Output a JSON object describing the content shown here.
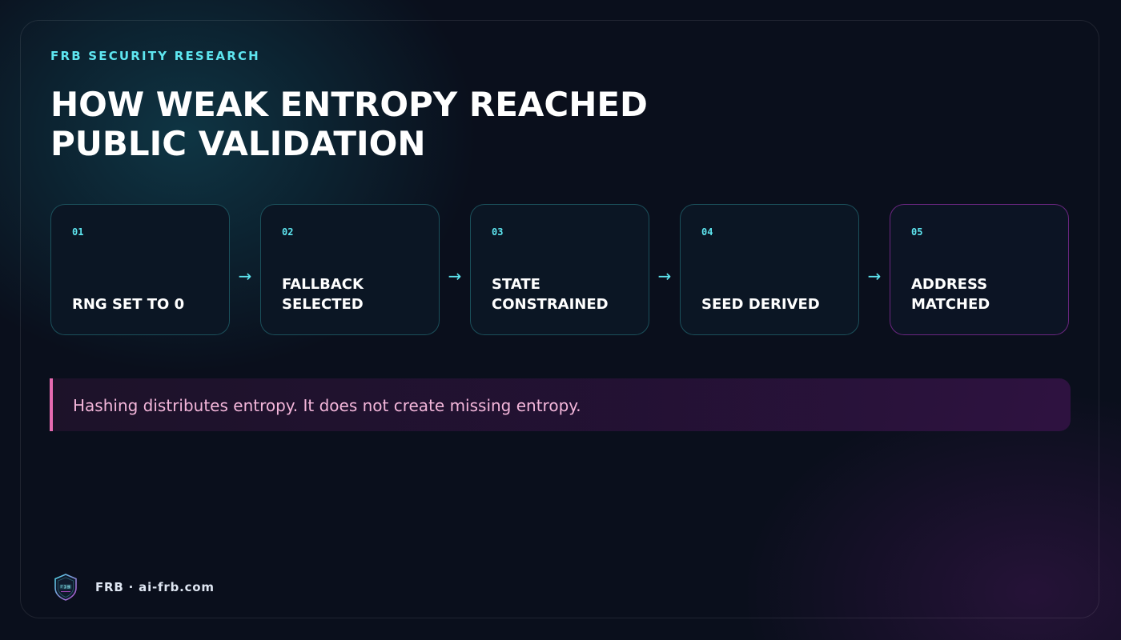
{
  "header": {
    "kicker": "FRB SECURITY RESEARCH",
    "title": "HOW WEAK ENTROPY REACHED PUBLIC VALIDATION"
  },
  "steps": [
    {
      "number": "01",
      "label": "RNG SET TO 0"
    },
    {
      "number": "02",
      "label": "FALLBACK SELECTED"
    },
    {
      "number": "03",
      "label": "STATE CONSTRAINED"
    },
    {
      "number": "04",
      "label": "SEED DERIVED"
    },
    {
      "number": "05",
      "label": "ADDRESS MATCHED"
    }
  ],
  "arrow_glyph": "→",
  "callout": {
    "text": "Hashing distributes entropy. It does not create missing entropy."
  },
  "footer": {
    "logo_icon": "frb-shield-logo",
    "text": "FRB · ai-frb.com"
  },
  "colors": {
    "background": "#0a0f1c",
    "accent_cyan": "#5ee6f0",
    "accent_pink": "#e66ab0",
    "accent_purple": "#aa32be"
  }
}
